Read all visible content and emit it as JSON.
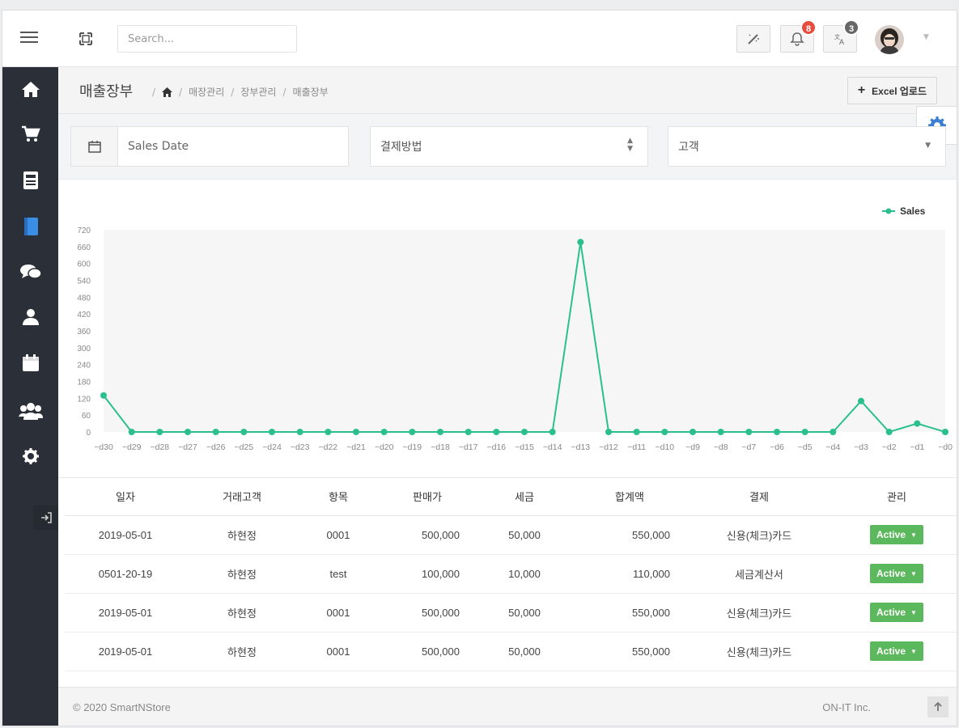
{
  "header": {
    "search_placeholder": "Search...",
    "notifications_count": "8",
    "notifications_badge_color": "#e74c3c",
    "messages_count": "3",
    "messages_badge_color": "#666666"
  },
  "sidebar": {
    "items": [
      {
        "icon": "home-icon"
      },
      {
        "icon": "cart-icon"
      },
      {
        "icon": "register-icon"
      },
      {
        "icon": "book-icon",
        "active": true,
        "active_color": "#3a8ee6"
      },
      {
        "icon": "chat-icon"
      },
      {
        "icon": "user-icon"
      },
      {
        "icon": "calendar-icon"
      },
      {
        "icon": "users-icon"
      },
      {
        "icon": "settings-icon"
      }
    ],
    "logout_icon": "sign-out-icon"
  },
  "page": {
    "title": "매출장부",
    "breadcrumb": [
      "매장관리",
      "장부관리",
      "매출장부"
    ],
    "excel_button": "Excel 업로드"
  },
  "filters": {
    "date_placeholder": "Sales Date",
    "payment_select": "결제방법",
    "customer_select": "고객"
  },
  "chart_data": {
    "type": "line",
    "legend": "Sales",
    "legend_position": "top-right",
    "color": "#2bbf8e",
    "x": [
      "~d30",
      "~d29",
      "~d28",
      "~d27",
      "~d26",
      "~d25",
      "~d24",
      "~d23",
      "~d22",
      "~d21",
      "~d20",
      "~d19",
      "~d18",
      "~d17",
      "~d16",
      "~d15",
      "~d14",
      "~d13",
      "~d12",
      "~d11",
      "~d10",
      "~d9",
      "~d8",
      "~d7",
      "~d6",
      "~d5",
      "~d4",
      "~d3",
      "~d2",
      "~d1",
      "~d0"
    ],
    "series": [
      {
        "name": "Sales",
        "values": [
          130,
          0,
          0,
          0,
          0,
          0,
          0,
          0,
          0,
          0,
          0,
          0,
          0,
          0,
          0,
          0,
          0,
          676,
          0,
          0,
          0,
          0,
          0,
          0,
          0,
          0,
          0,
          110,
          0,
          30,
          0
        ]
      }
    ],
    "ylim": [
      0,
      720
    ],
    "yticks": [
      0,
      60,
      120,
      180,
      240,
      300,
      360,
      420,
      480,
      540,
      600,
      660,
      720
    ],
    "grid": false
  },
  "table": {
    "headers": [
      "일자",
      "거래고객",
      "항목",
      "판매가",
      "세금",
      "합계액",
      "결제",
      "관리"
    ],
    "rows": [
      [
        "2019-05-01",
        "하현정",
        "0001",
        "500,000",
        "50,000",
        "550,000",
        "신용(체크)카드",
        "Active"
      ],
      [
        "0501-20-19",
        "하현정",
        "test",
        "100,000",
        "10,000",
        "110,000",
        "세금계산서",
        "Active"
      ],
      [
        "2019-05-01",
        "하현정",
        "0001",
        "500,000",
        "50,000",
        "550,000",
        "신용(체크)카드",
        "Active"
      ],
      [
        "2019-05-01",
        "하현정",
        "0001",
        "500,000",
        "50,000",
        "550,000",
        "신용(체크)카드",
        "Active"
      ]
    ]
  },
  "footer": {
    "copyright": "© 2020 SmartNStore",
    "company": "ON-IT Inc."
  }
}
